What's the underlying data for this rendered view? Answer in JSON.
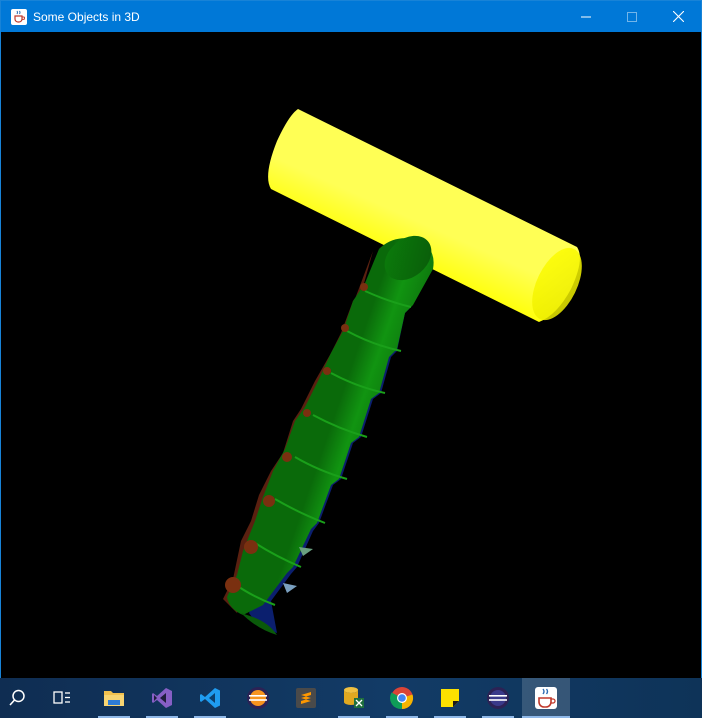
{
  "window": {
    "title": "Some Objects in 3D",
    "icon": "java-cup-icon",
    "controls": [
      "minimize-icon",
      "maximize-icon",
      "close-icon"
    ]
  },
  "scene": {
    "background": "#000000",
    "objects": [
      {
        "name": "yellow-cylinder",
        "color": "#ffff00"
      },
      {
        "name": "green-helical-cone",
        "color": "#008000"
      }
    ]
  },
  "taskbar": {
    "items": [
      {
        "name": "search-icon",
        "running": false
      },
      {
        "name": "task-view-icon",
        "running": false
      },
      {
        "name": "file-explorer-icon",
        "running": true
      },
      {
        "name": "visual-studio-icon",
        "running": true
      },
      {
        "name": "vs-code-icon",
        "running": true
      },
      {
        "name": "eclipse-icon",
        "running": false
      },
      {
        "name": "sublime-text-icon",
        "running": false
      },
      {
        "name": "database-tool-icon",
        "running": true
      },
      {
        "name": "chrome-icon",
        "running": true
      },
      {
        "name": "sticky-notes-icon",
        "running": true
      },
      {
        "name": "eclipse-icon",
        "running": true
      },
      {
        "name": "java-app-icon",
        "running": true,
        "active": true
      }
    ]
  }
}
